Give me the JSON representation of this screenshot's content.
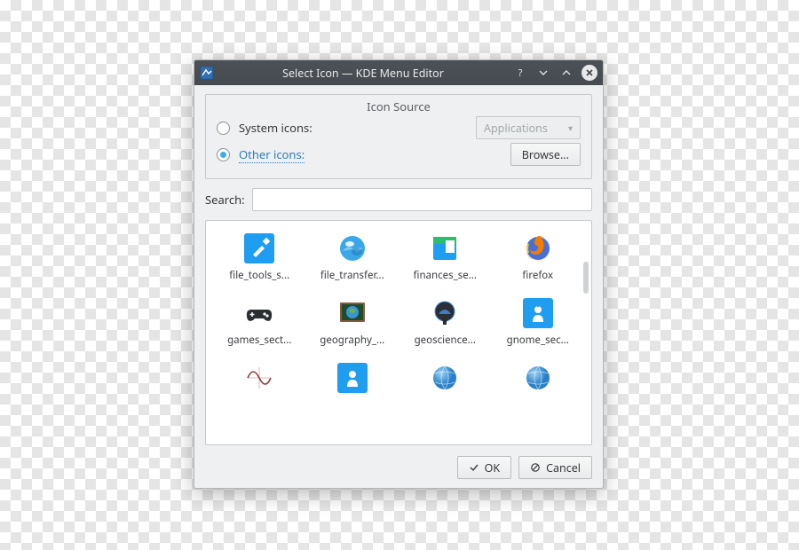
{
  "window": {
    "title": "Select Icon — KDE Menu Editor"
  },
  "group": {
    "legend": "Icon Source",
    "system_label": "System icons:",
    "other_label": "Other icons:",
    "combo_value": "Applications",
    "browse_label": "Browse..."
  },
  "search": {
    "label": "Search:",
    "value": ""
  },
  "icons": [
    {
      "name": "file_tools_s..."
    },
    {
      "name": "file_transfer..."
    },
    {
      "name": "finances_se..."
    },
    {
      "name": "firefox"
    },
    {
      "name": "games_sect..."
    },
    {
      "name": "geography_..."
    },
    {
      "name": "geoscience..."
    },
    {
      "name": "gnome_sec..."
    },
    {
      "name": ""
    },
    {
      "name": ""
    },
    {
      "name": ""
    },
    {
      "name": ""
    }
  ],
  "buttons": {
    "ok": "OK",
    "cancel": "Cancel"
  }
}
